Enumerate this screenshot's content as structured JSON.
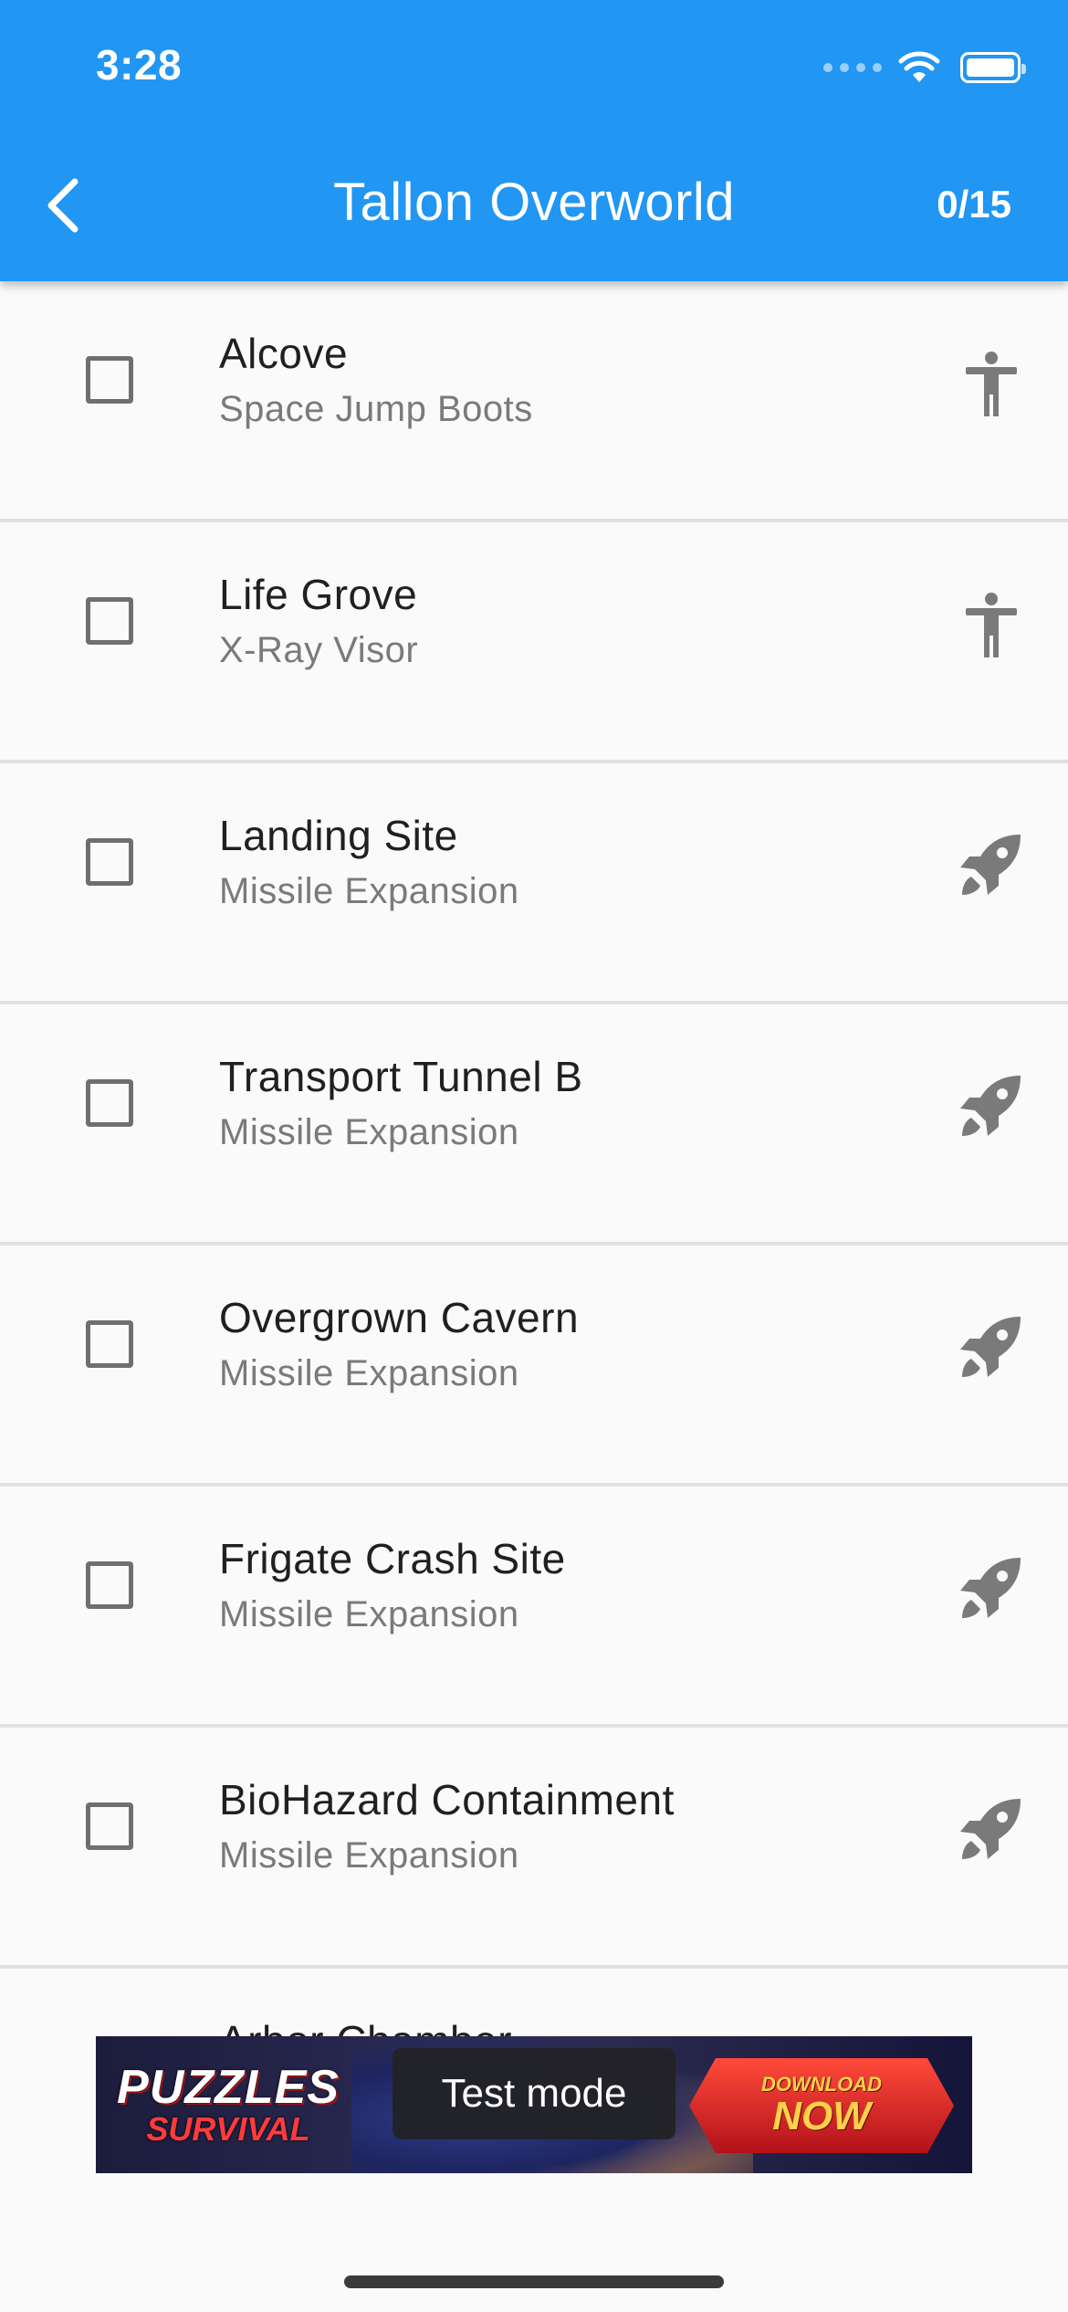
{
  "status_bar": {
    "time": "3:28"
  },
  "header": {
    "title": "Tallon Overworld",
    "counter": "0/15",
    "back_icon": "chevron-left-icon"
  },
  "colors": {
    "app_bar": "#2196f3",
    "icon_gray": "#7a7a7a"
  },
  "items": [
    {
      "title": "Alcove",
      "subtitle": "Space Jump Boots",
      "icon": "person-icon",
      "checked": false
    },
    {
      "title": "Life Grove",
      "subtitle": "X-Ray Visor",
      "icon": "person-icon",
      "checked": false
    },
    {
      "title": "Landing Site",
      "subtitle": "Missile Expansion",
      "icon": "rocket-icon",
      "checked": false
    },
    {
      "title": "Transport Tunnel B",
      "subtitle": "Missile Expansion",
      "icon": "rocket-icon",
      "checked": false
    },
    {
      "title": "Overgrown Cavern",
      "subtitle": "Missile Expansion",
      "icon": "rocket-icon",
      "checked": false
    },
    {
      "title": "Frigate Crash Site",
      "subtitle": "Missile Expansion",
      "icon": "rocket-icon",
      "checked": false
    },
    {
      "title": "BioHazard Containment",
      "subtitle": "Missile Expansion",
      "icon": "rocket-icon",
      "checked": false
    },
    {
      "title": "Arbor Chamber",
      "subtitle": "",
      "icon": "rocket-icon",
      "checked": false
    }
  ],
  "ad": {
    "logo_line1": "PUZZLES",
    "logo_line2": "SURVIVAL",
    "cta_line1": "DOWNLOAD",
    "cta_line2": "NOW",
    "badge": "Test mode"
  }
}
